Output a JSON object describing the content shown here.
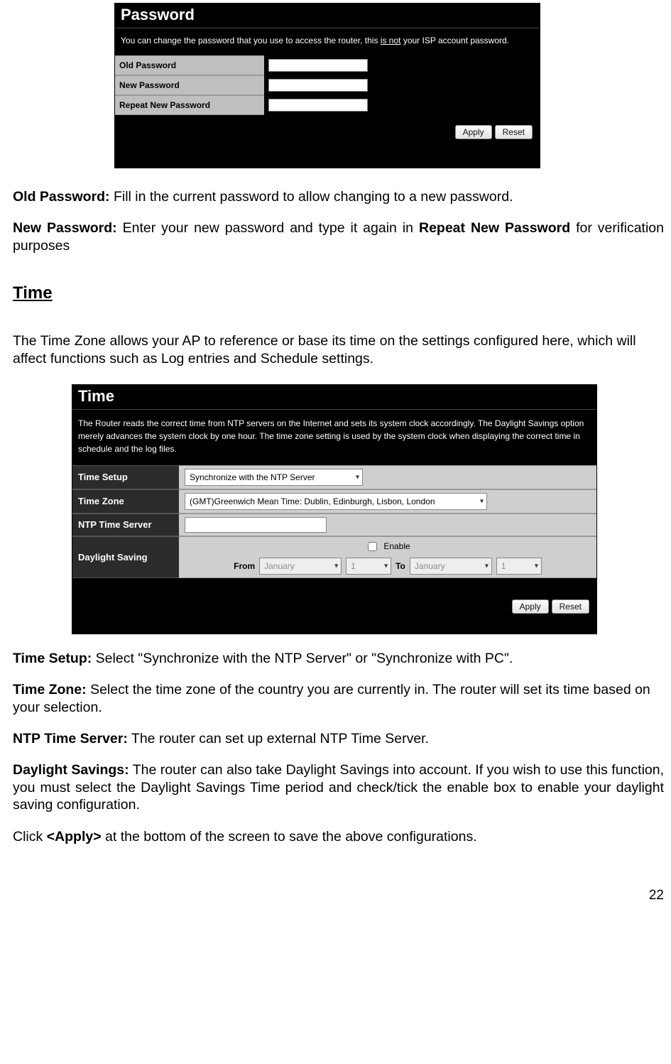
{
  "password_panel": {
    "title": "Password",
    "desc_pre": "You can change the password that you use to access the router, this ",
    "desc_underlined": "is not",
    "desc_post": " your ISP account password.",
    "rows": {
      "old": "Old Password",
      "new": "New Password",
      "repeat": "Repeat New Password"
    },
    "apply": "Apply",
    "reset": "Reset"
  },
  "body": {
    "p1_bold": "Old Password:",
    "p1_text": " Fill in the current password to allow changing to a new password.",
    "p2_bold": "New Password:",
    "p2_text_a": " Enter your new password and type it again in ",
    "p2_bold_b": "Repeat New Password",
    "p2_text_b": " for verification purposes",
    "time_heading": "Time",
    "time_intro": "The Time Zone allows your AP to reference or base its time on the settings configured here, which will affect functions such as Log entries and Schedule settings."
  },
  "time_panel": {
    "title": "Time",
    "desc": "The Router reads the correct time from NTP servers on the Internet and sets its system clock accordingly. The Daylight Savings option merely advances the system clock by one hour. The time zone setting is used by the system clock when displaying the correct time in schedule and the log files.",
    "labels": {
      "setup": "Time Setup",
      "zone": "Time Zone",
      "ntp": "NTP Time Server",
      "daylight": "Daylight Saving"
    },
    "values": {
      "setup": "Synchronize with the NTP Server",
      "zone": "(GMT)Greenwich Mean Time: Dublin, Edinburgh, Lisbon, London",
      "ntp": "",
      "enable_label": "Enable",
      "from_label": "From",
      "to_label": "To",
      "month_from": "January",
      "day_from": "1",
      "month_to": "January",
      "day_to": "1"
    },
    "apply": "Apply",
    "reset": "Reset"
  },
  "body2": {
    "ts_bold": "Time Setup:",
    "ts_text": " Select \"Synchronize with the NTP Server\" or \"Synchronize with PC\".",
    "tz_bold": "Time Zone:",
    "tz_text": " Select the time zone of the country you are currently in. The router will set its time based on your selection.",
    "ntp_bold": "NTP Time Server:",
    "ntp_text": " The router can set up external NTP Time Server.",
    "ds_bold": "Daylight Savings:",
    "ds_text": " The router can also take Daylight Savings into account. If you wish to use this function, you must select the Daylight Savings Time period and check/tick the enable box to enable your daylight saving configuration.",
    "apply_pre": "Click ",
    "apply_bold": "<Apply>",
    "apply_post": " at the bottom of the screen to save the above configurations."
  },
  "page_number": "22"
}
